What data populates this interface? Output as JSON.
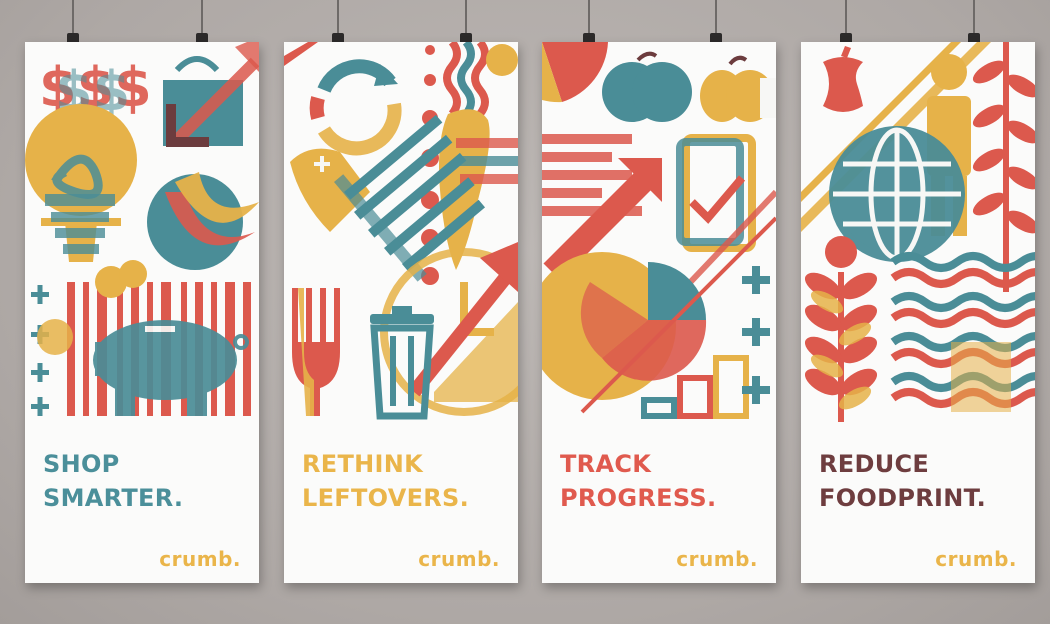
{
  "colors": {
    "teal": "#4b8f9a",
    "red": "#e05a4e",
    "yellow": "#eab54a",
    "brown": "#6e3d3f",
    "wall": "#b3aeab"
  },
  "brand": "crumb.",
  "posters": [
    {
      "line1": "SHOP",
      "line2": "SMARTER.",
      "headline_color": "#4b8f9a"
    },
    {
      "line1": "RETHINK",
      "line2": "LEFTOVERS.",
      "headline_color": "#eab54a"
    },
    {
      "line1": "TRACK",
      "line2": "PROGRESS.",
      "headline_color": "#e05a4e"
    },
    {
      "line1": "REDUCE",
      "line2": "FOODPRINT.",
      "headline_color": "#6e3d3f"
    }
  ],
  "icons": {
    "poster1": [
      "dollar-signs-icon",
      "shopping-bag-icon",
      "lightbulb-icon",
      "banana-icon",
      "barcode-icon",
      "piggy-bank-icon",
      "plus-icons"
    ],
    "poster2": [
      "recycle-arrows-icon",
      "fish-bone-icon",
      "carrot-icon",
      "fork-icon",
      "trash-can-icon",
      "clock-icon",
      "arrow-icon"
    ],
    "poster3": [
      "pie-chart-icon",
      "apple-icon",
      "tablet-check-icon",
      "trend-arrow-icon",
      "bar-chart-icon",
      "plus-icons"
    ],
    "poster4": [
      "apple-core-icon",
      "person-icon",
      "globe-icon",
      "wheat-icon",
      "wave-lines-icon",
      "leaf-branch-icon"
    ]
  }
}
